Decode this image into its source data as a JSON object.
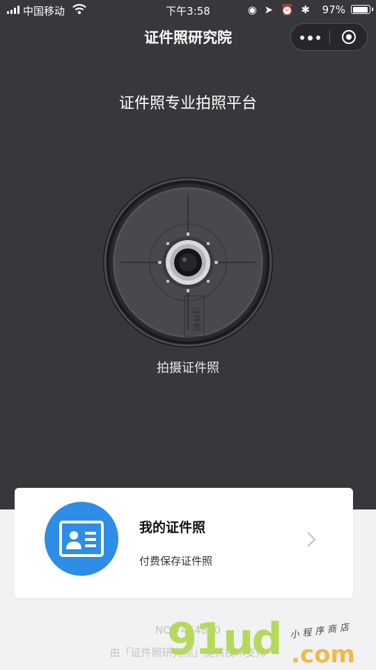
{
  "status": {
    "carrier": "中国移动",
    "time": "下午3:58",
    "icons": "◉ ➤ ⏰ ✱",
    "battery": "97%",
    "battery_level": 0.97
  },
  "nav": {
    "title": "证件照研究院"
  },
  "hero": {
    "subtitle": "证件照专业拍照平台",
    "lens_text": "证件照",
    "shoot_label": "拍摄证件照"
  },
  "card": {
    "title": "我的证件照",
    "subtitle": "付费保存证件照",
    "icon": "id-card-icon"
  },
  "footer": {
    "number": "NO.7464860",
    "support": "由「证件照研究院」提供技术支持"
  },
  "watermark": {
    "main": "91ud",
    "domain": ".com",
    "tag": "小程序商店"
  },
  "colors": {
    "background_dark": "#38373c",
    "accent_blue": "#2e8de6"
  }
}
